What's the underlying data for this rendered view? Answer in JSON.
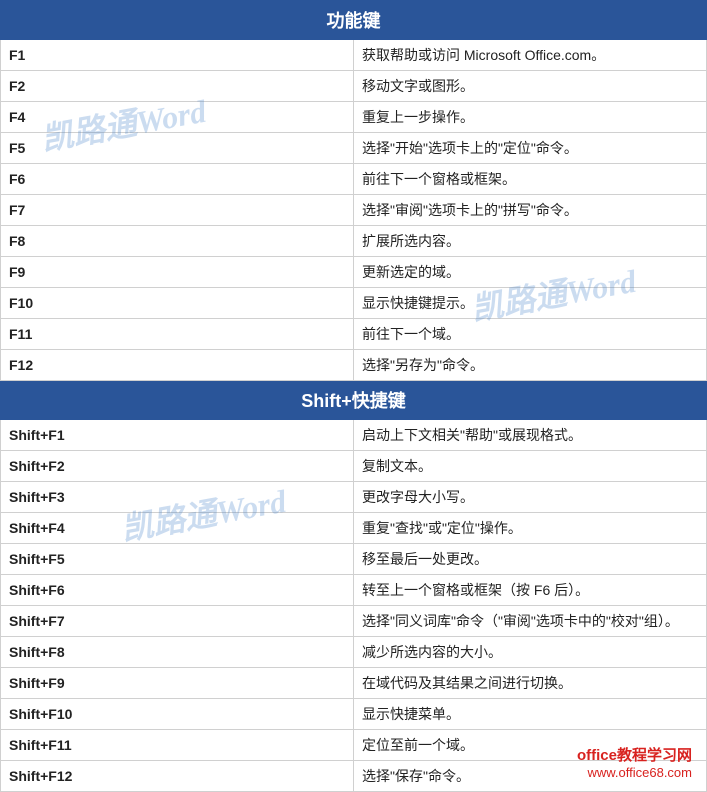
{
  "sections": [
    {
      "title": "功能键",
      "rows": [
        {
          "key": "F1",
          "desc": "获取帮助或访问 Microsoft Office.com。"
        },
        {
          "key": "F2",
          "desc": "移动文字或图形。"
        },
        {
          "key": "F4",
          "desc": "重复上一步操作。"
        },
        {
          "key": "F5",
          "desc": "选择\"开始\"选项卡上的\"定位\"命令。"
        },
        {
          "key": "F6",
          "desc": "前往下一个窗格或框架。"
        },
        {
          "key": "F7",
          "desc": "选择\"审阅\"选项卡上的\"拼写\"命令。"
        },
        {
          "key": "F8",
          "desc": "扩展所选内容。"
        },
        {
          "key": "F9",
          "desc": "更新选定的域。"
        },
        {
          "key": "F10",
          "desc": "显示快捷键提示。"
        },
        {
          "key": "F11",
          "desc": "前往下一个域。"
        },
        {
          "key": "F12",
          "desc": "选择\"另存为\"命令。"
        }
      ]
    },
    {
      "title": "Shift+快捷键",
      "rows": [
        {
          "key": "Shift+F1",
          "desc": "启动上下文相关\"帮助\"或展现格式。"
        },
        {
          "key": "Shift+F2",
          "desc": "复制文本。"
        },
        {
          "key": "Shift+F3",
          "desc": "更改字母大小写。"
        },
        {
          "key": "Shift+F4",
          "desc": "重复\"查找\"或\"定位\"操作。"
        },
        {
          "key": "Shift+F5",
          "desc": "移至最后一处更改。"
        },
        {
          "key": "Shift+F6",
          "desc": "转至上一个窗格或框架（按 F6 后）。"
        },
        {
          "key": "Shift+F7",
          "desc": "选择\"同义词库\"命令（\"审阅\"选项卡中的\"校对\"组）。"
        },
        {
          "key": "Shift+F8",
          "desc": "减少所选内容的大小。"
        },
        {
          "key": "Shift+F9",
          "desc": "在域代码及其结果之间进行切换。"
        },
        {
          "key": "Shift+F10",
          "desc": "显示快捷菜单。"
        },
        {
          "key": "Shift+F11",
          "desc": "定位至前一个域。"
        },
        {
          "key": "Shift+F12",
          "desc": "选择\"保存\"命令。"
        }
      ]
    }
  ],
  "watermark_text": "凯路通Word",
  "footer": {
    "line1": "office教程学习网",
    "line2": "www.office68.com"
  }
}
